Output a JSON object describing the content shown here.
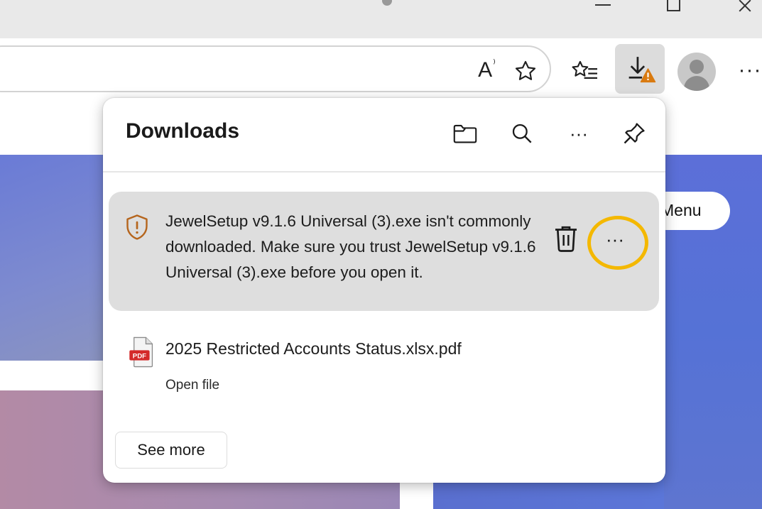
{
  "toolbar": {
    "read_aloud_label": "A",
    "read_aloud_sup": "⁾",
    "more_label": "···",
    "icons": [
      "read-aloud-icon",
      "star-icon",
      "favorites-icon",
      "download-icon",
      "profile-icon",
      "more-icon"
    ]
  },
  "page": {
    "menu_button_label": "Menu"
  },
  "downloads": {
    "title": "Downloads",
    "header_more_label": "···",
    "warning_item": {
      "lines": [
        "JewelSetup v9.1.6 Universal (3).exe isn't commonly",
        "downloaded. Make sure you trust JewelSetup v9.1.6",
        "Universal (3).exe before you open it."
      ],
      "more_label": "···"
    },
    "file_item": {
      "name": "2025 Restricted Accounts Status.xlsx.pdf",
      "action": "Open file",
      "icon_label": "PDF"
    },
    "see_more_label": "See more"
  },
  "colors": {
    "highlight_ring": "#f4b800",
    "warning_shield": "#b5651d",
    "warning_badge": "#d97a10",
    "pdf_red": "#d42a2a"
  }
}
